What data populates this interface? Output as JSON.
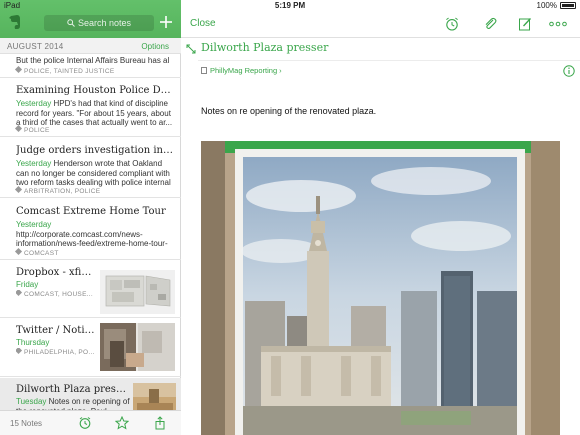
{
  "status_bar": {
    "device": "iPad",
    "time": "5:19 PM",
    "battery": "100%"
  },
  "sidebar": {
    "search_placeholder": "Search notes",
    "month_label": "AUGUST 2014",
    "options_label": "Options",
    "notes": [
      {
        "title": "",
        "date": "",
        "snippet": "But the police Internal Affairs Bureau has al",
        "tags": "POLICE, TAINTED JUSTICE"
      },
      {
        "title": "Examining Houston Police Depart...",
        "date": "Yesterday",
        "snippet": " HPD's had that kind of discipline record for years. \"For about 15 years, about a third of the cases that actually went to ar...",
        "tags": "POLICE"
      },
      {
        "title": "Judge orders investigation into Oa...",
        "date": "Yesterday",
        "snippet": " Henderson wrote that Oakland can no longer be considered compliant with two reform tasks dealing with police internal a...",
        "tags": "ARBITRATION, POLICE"
      },
      {
        "title": "Comcast Extreme Home Tour",
        "date": "Yesterday",
        "snippet": " http://corporate.comcast.com/news-information/news-feed/extreme-home-tour-showcases-comcasts-smart-home-solution",
        "tags": "COMCAST"
      },
      {
        "title": "Dropbox - xfin...",
        "date": "Friday",
        "snippet": "",
        "tags": "COMCAST, HOUSE..."
      },
      {
        "title": "Twitter / Notifi...",
        "date": "Thursday",
        "snippet": "",
        "tags": "PHILADELPHIA, PO..."
      },
      {
        "title": "Dilworth Plaza presser",
        "date": "Tuesday",
        "snippet": " Notes on re opening of the renovated plaza. Paul Levy...",
        "tags": ""
      }
    ],
    "footer_count": "15 Notes"
  },
  "editor": {
    "close_label": "Close",
    "title": "Dilworth Plaza presser",
    "notebook": "PhillyMag Reporting",
    "content": "Notes on re opening of the renovated plaza."
  },
  "colors": {
    "accent": "#3aa64b",
    "header_green": "#5cb85c"
  }
}
